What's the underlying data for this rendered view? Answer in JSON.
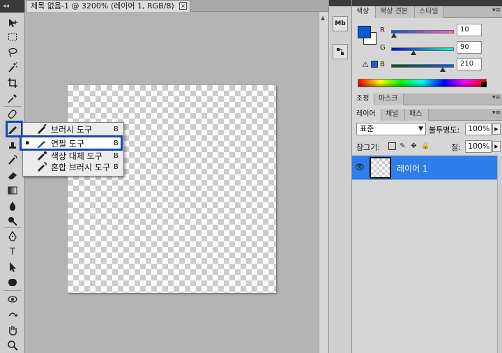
{
  "document": {
    "tab_title": "제목 없음-1 @ 3200% (레이어 1, RGB/8)",
    "close_glyph": "×"
  },
  "flyout": {
    "items": [
      {
        "label": "브러시 도구",
        "shortcut": "B",
        "icon": "brush-icon",
        "selected": false
      },
      {
        "label": "연필 도구",
        "shortcut": "B",
        "icon": "pencil-icon",
        "selected": true
      },
      {
        "label": "색상 대체 도구",
        "shortcut": "B",
        "icon": "color-replace-icon",
        "selected": false
      },
      {
        "label": "혼합 브러시 도구",
        "shortcut": "B",
        "icon": "mixer-brush-icon",
        "selected": false
      }
    ],
    "selected_bullet": "▪"
  },
  "dock": {
    "mb_label": "Mb"
  },
  "color_panel": {
    "tabs": [
      "색상",
      "색상 견본",
      "스타일"
    ],
    "active_tab": 0,
    "menu_glyph": "▾≡",
    "foreground": "#0a5ad2",
    "background": "#ffffff",
    "channels": [
      {
        "name": "R",
        "value": "10",
        "gradient": "linear-gradient(to right,#0a5ad2,#ff5ad2)",
        "thumb_pos": 0.04
      },
      {
        "name": "G",
        "value": "90",
        "gradient": "linear-gradient(to right,#0a00d2,#0affd2)",
        "thumb_pos": 0.35
      },
      {
        "name": "B",
        "value": "210",
        "gradient": "linear-gradient(to right,#0a5a00,#0a5aff)",
        "thumb_pos": 0.82
      }
    ],
    "warning_glyph": "⚠"
  },
  "adjust_panel": {
    "tabs": [
      "조정",
      "마스크"
    ],
    "active_tab": 0
  },
  "layers_panel": {
    "tabs": [
      "레이어",
      "채널",
      "패스"
    ],
    "active_tab": 0,
    "blend_mode": "표준",
    "opacity_label": "불투명도:",
    "opacity_value": "100%",
    "lock_label": "잠그기:",
    "fill_label": "칠:",
    "fill_value": "100%",
    "layers": [
      {
        "name": "레이어 1",
        "visible": true,
        "selected": true
      }
    ],
    "eye_glyph": "👁"
  },
  "toolbar": {
    "collapse_glyph": "◂◂"
  },
  "colors": {
    "highlight": "#1446b8",
    "selection": "#2e7de8"
  }
}
